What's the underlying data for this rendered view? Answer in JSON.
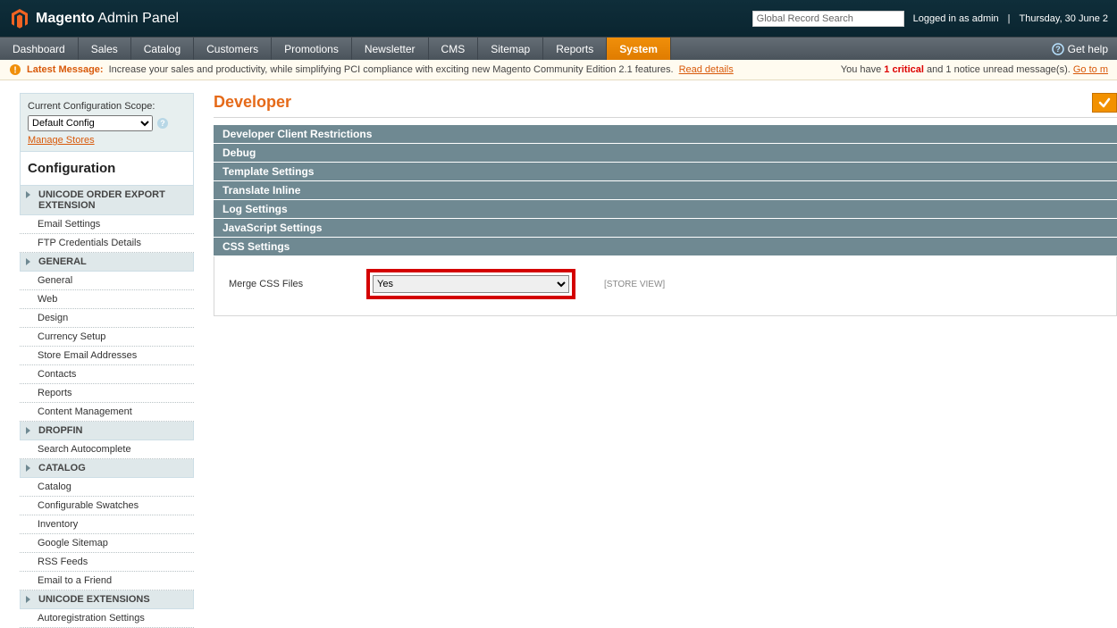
{
  "topbar": {
    "brand_bold": "Magento",
    "brand_rest": "Admin Panel",
    "search_placeholder": "Global Record Search",
    "logged_in": "Logged in as admin",
    "sep": "|",
    "date": "Thursday, 30 June 2"
  },
  "menu": {
    "items": [
      "Dashboard",
      "Sales",
      "Catalog",
      "Customers",
      "Promotions",
      "Newsletter",
      "CMS",
      "Sitemap",
      "Reports",
      "System"
    ],
    "active": "System",
    "help": "Get help"
  },
  "notify": {
    "latest_label": "Latest Message:",
    "msg": "Increase your sales and productivity, while simplifying PCI compliance with exciting new Magento Community Edition 2.1 features.",
    "read_details": "Read details",
    "right_prefix": "You have ",
    "critical_count": "1 critical",
    "right_mid": " and 1 notice unread message(s). ",
    "goto": "Go to m"
  },
  "sidebar": {
    "scope_label": "Current Configuration Scope:",
    "scope_selected": "Default Config",
    "manage_stores": "Manage Stores",
    "config_header": "Configuration",
    "groups": [
      {
        "title": "UNICODE ORDER EXPORT EXTENSION",
        "items": [
          "Email Settings",
          "FTP Credentials Details"
        ]
      },
      {
        "title": "GENERAL",
        "items": [
          "General",
          "Web",
          "Design",
          "Currency Setup",
          "Store Email Addresses",
          "Contacts",
          "Reports",
          "Content Management"
        ]
      },
      {
        "title": "DROPFIN",
        "items": [
          "Search Autocomplete"
        ]
      },
      {
        "title": "CATALOG",
        "items": [
          "Catalog",
          "Configurable Swatches",
          "Inventory",
          "Google Sitemap",
          "RSS Feeds",
          "Email to a Friend"
        ]
      },
      {
        "title": "UNICODE EXTENSIONS",
        "items": [
          "Autoregistration Settings"
        ]
      }
    ]
  },
  "page": {
    "title": "Developer",
    "save_label": " ",
    "sections": [
      "Developer Client Restrictions",
      "Debug",
      "Template Settings",
      "Translate Inline",
      "Log Settings",
      "JavaScript Settings",
      "CSS Settings"
    ],
    "css": {
      "label": "Merge CSS Files",
      "value": "Yes",
      "scope": "[STORE VIEW]"
    }
  }
}
